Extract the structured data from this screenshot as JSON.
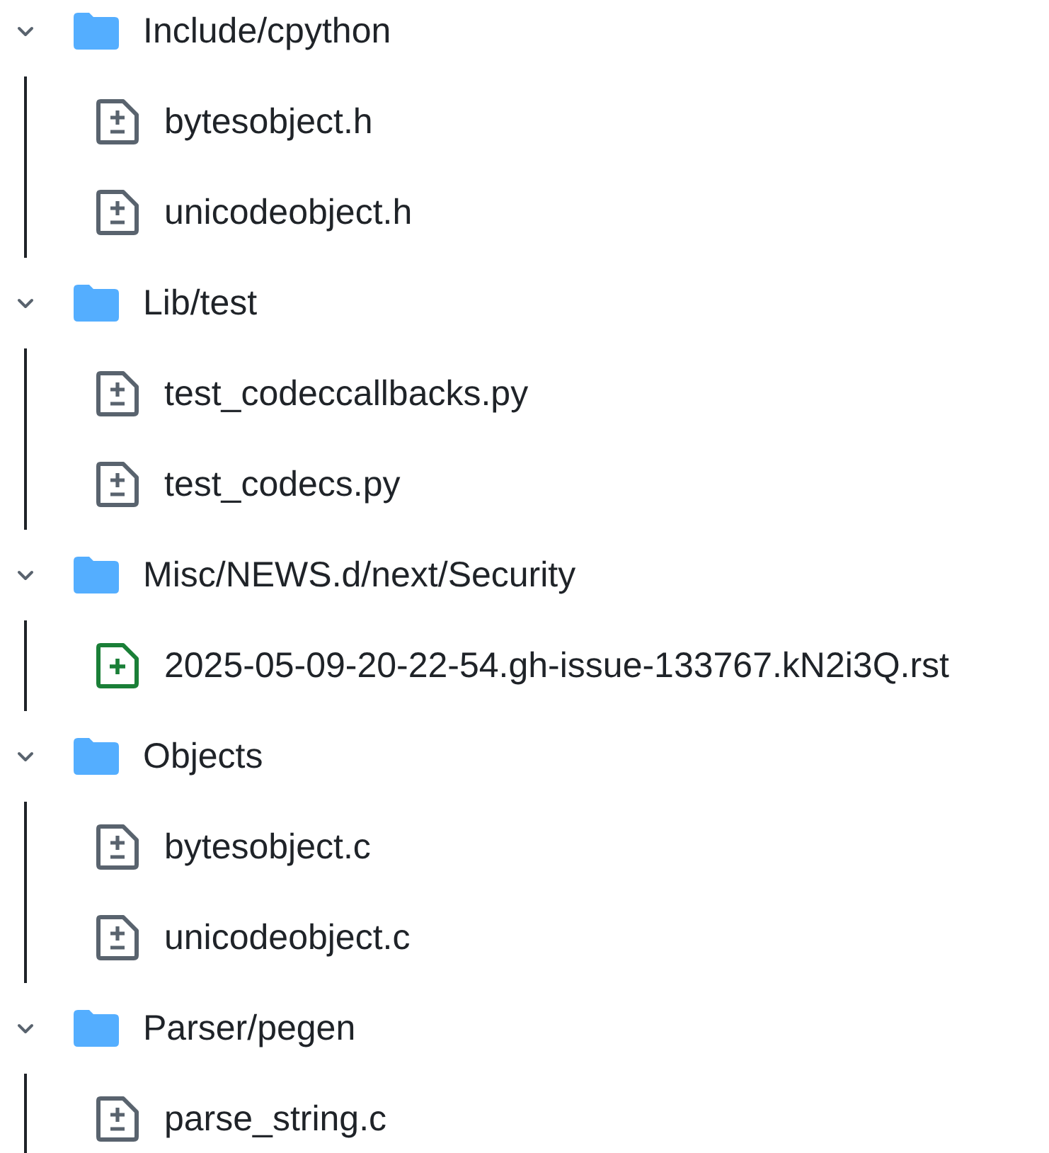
{
  "tree": [
    {
      "name": "Include/cpython",
      "expanded": true,
      "children": [
        {
          "name": "bytesobject.h",
          "kind": "modified"
        },
        {
          "name": "unicodeobject.h",
          "kind": "modified"
        }
      ]
    },
    {
      "name": "Lib/test",
      "expanded": true,
      "children": [
        {
          "name": "test_codeccallbacks.py",
          "kind": "modified"
        },
        {
          "name": "test_codecs.py",
          "kind": "modified"
        }
      ]
    },
    {
      "name": "Misc/NEWS.d/next/Security",
      "expanded": true,
      "children": [
        {
          "name": "2025-05-09-20-22-54.gh-issue-133767.kN2i3Q.rst",
          "kind": "added"
        }
      ]
    },
    {
      "name": "Objects",
      "expanded": true,
      "children": [
        {
          "name": "bytesobject.c",
          "kind": "modified"
        },
        {
          "name": "unicodeobject.c",
          "kind": "modified"
        }
      ]
    },
    {
      "name": "Parser/pegen",
      "expanded": true,
      "children": [
        {
          "name": "parse_string.c",
          "kind": "modified"
        }
      ]
    }
  ]
}
